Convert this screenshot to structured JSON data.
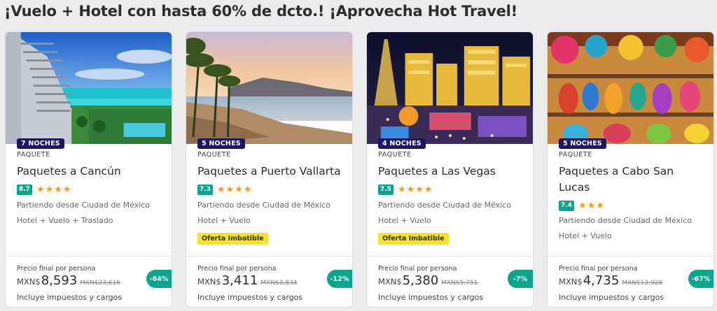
{
  "headline": "¡Vuelo + Hotel con hasta 60% de dcto.! ¡Aprovecha Hot Travel!",
  "cards": [
    {
      "nights": "7 NOCHES",
      "type": "PAQUETE",
      "title": "Paquetes a Cancún",
      "score": "8.7",
      "stars": "★★★★",
      "origin": "Partiendo desde Ciudad de México",
      "includes": "Hotel + Vuelo + Traslado",
      "offer": "",
      "price_label": "Precio final por persona",
      "currency": "MXN$",
      "price": "8,593",
      "old_price": "MXN$23,616",
      "taxes": "Incluye impuestos y cargos",
      "discount": "-64%",
      "image": "cancun-hotel-beach-photo"
    },
    {
      "nights": "5 NOCHES",
      "type": "PAQUETE",
      "title": "Paquetes a Puerto Vallarta",
      "score": "7.3",
      "stars": "★★★★",
      "origin": "Partiendo desde Ciudad de México",
      "includes": "Hotel + Vuelo",
      "offer": "Oferta Imbatible",
      "price_label": "Precio final por persona",
      "currency": "MXN$",
      "price": "3,411",
      "old_price": "MXN$3,834",
      "taxes": "Incluye impuestos y cargos",
      "discount": "-12%",
      "image": "puerto-vallarta-beach-photo"
    },
    {
      "nights": "4 NOCHES",
      "type": "PAQUETE",
      "title": "Paquetes a Las Vegas",
      "score": "7.5",
      "stars": "★★★★",
      "origin": "Partiendo desde Ciudad de México",
      "includes": "Hotel + Vuelo",
      "offer": "Oferta Imbatible",
      "price_label": "Precio final por persona",
      "currency": "MXN$",
      "price": "5,380",
      "old_price": "MXN$5,751",
      "taxes": "Incluye impuestos y cargos",
      "discount": "-7%",
      "image": "las-vegas-night-strip-photo"
    },
    {
      "nights": "5 NOCHES",
      "type": "PAQUETE",
      "title": "Paquetes a Cabo San Lucas",
      "score": "7.4",
      "stars": "★★★",
      "origin": "Partiendo desde Ciudad de México",
      "includes": "Hotel + Vuelo",
      "offer": "",
      "price_label": "Precio final por persona",
      "currency": "MXN$",
      "price": "4,735",
      "old_price": "MXN$13,928",
      "taxes": "Incluye impuestos y cargos",
      "discount": "-67%",
      "image": "mexican-handicrafts-market-photo"
    }
  ],
  "colors": {
    "nights_badge": "#1e1660",
    "score_badge": "#0aa58c",
    "discount_badge": "#0aa58c",
    "stars": "#f39c12",
    "offer_badge": "#f4e22c"
  }
}
